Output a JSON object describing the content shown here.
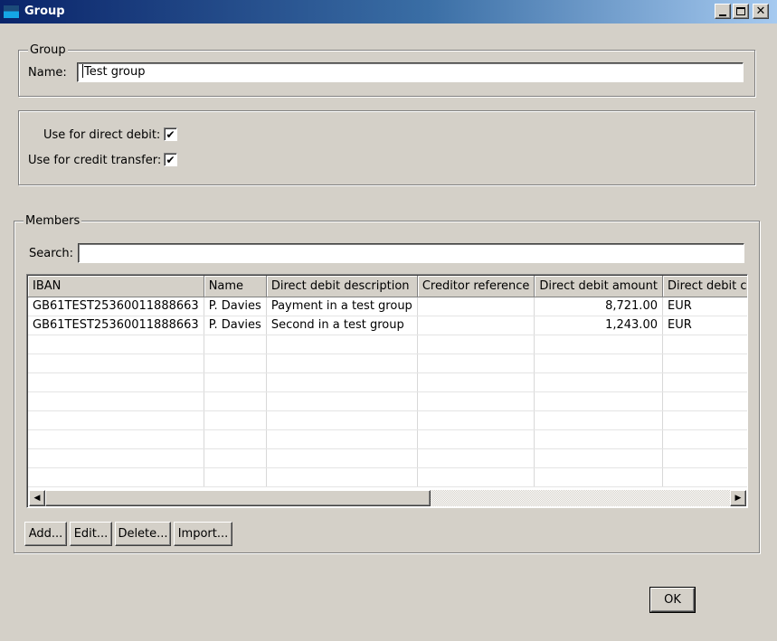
{
  "window": {
    "title": "Group",
    "minimize_glyph": "",
    "maximize_glyph": "",
    "close_glyph": "✕"
  },
  "group": {
    "legend": "Group",
    "name_label": "Name:",
    "name_value": "Test group"
  },
  "options": {
    "direct_debit_label": "Use for direct debit:",
    "direct_debit_checked": true,
    "credit_transfer_label": "Use for credit transfer:",
    "credit_transfer_checked": true,
    "check_glyph": "✔"
  },
  "members": {
    "legend": "Members",
    "search_label": "Search:",
    "search_value": "",
    "columns": [
      "IBAN",
      "Name",
      "Direct debit description",
      "Creditor reference",
      "Direct debit amount",
      "Direct debit currency"
    ],
    "rows": [
      [
        "GB61TEST25360011888663",
        "P. Davies",
        "Payment in a test group",
        "",
        "8,721.00",
        "EUR"
      ],
      [
        "GB61TEST25360011888663",
        "P. Davies",
        "Second in a test group",
        "",
        "1,243.00",
        "EUR"
      ]
    ],
    "scroll_left_icon": "◀",
    "scroll_right_icon": "▶",
    "buttons": {
      "add": "Add...",
      "edit": "Edit...",
      "delete": "Delete...",
      "import": "Import..."
    }
  },
  "footer": {
    "ok": "OK"
  },
  "colors": {
    "titlebar_start": "#0a246a",
    "titlebar_end": "#a6caf0",
    "window_bg": "#d4d0c8"
  }
}
